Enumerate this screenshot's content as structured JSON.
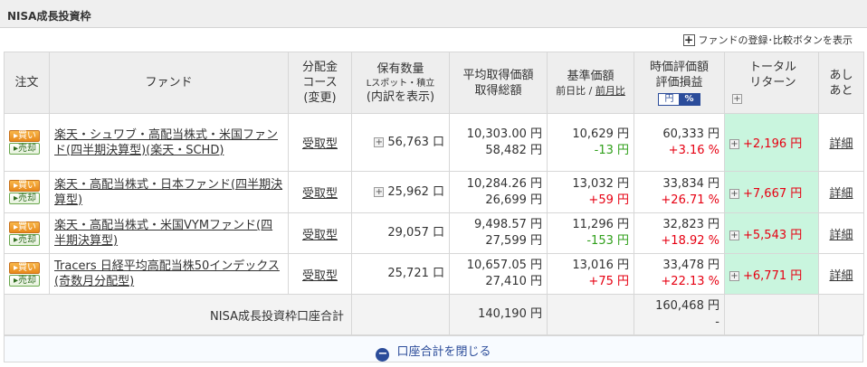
{
  "section_title": "NISA成長投資枠",
  "register_link": "ファンドの登録･比較ボタンを表示",
  "icons": {
    "plus": "plus-square-icon",
    "expand": "expand-plus-icon",
    "collapse": "minus-circle-icon"
  },
  "headers": {
    "order": "注文",
    "fund": "ファンド",
    "dist_l1": "分配金",
    "dist_l2": "コース",
    "dist_l3": "(変更)",
    "qty_l1": "保有数量",
    "qty_sub": "Lスポット・積立",
    "qty_l3": "(内訳を表示)",
    "avg_l1": "平均取得価額",
    "avg_l2": "取得総額",
    "nav_l1": "基準価額",
    "nav_sub_a": "前日比",
    "nav_sub_sep": " / ",
    "nav_sub_b": "前月比",
    "mv_l1": "時価評価額",
    "mv_l2": "評価損益",
    "toggle_yen": "円",
    "toggle_pct": "%",
    "tr_l1": "トータル",
    "tr_l2": "リターン",
    "ashi_l1": "あし",
    "ashi_l2": "あと"
  },
  "buttons": {
    "buy": "買い",
    "sell": "売却"
  },
  "colors": {
    "positive": "#e60012",
    "negative": "#2f9f1a",
    "accent": "#2b4c9a",
    "total_return_bg": "#c9f5de",
    "buy_button": "#f0a030"
  },
  "rows": [
    {
      "fund": "楽天・シュワブ・高配当株式・米国ファンド(四半期決算型)(楽天・SCHD)",
      "dist": "受取型",
      "qty": "56,763 口",
      "has_breakdown": true,
      "avg_price": "10,303.00 円",
      "total_cost": "58,482 円",
      "nav": "10,629 円",
      "nav_change": "-13 円",
      "market_value": "60,333 円",
      "pl_pct": "+3.16 %",
      "total_return": "+2,196 円",
      "detail": "詳細"
    },
    {
      "fund": "楽天・高配当株式・日本ファンド(四半期決算型)",
      "dist": "受取型",
      "qty": "25,962 口",
      "has_breakdown": true,
      "avg_price": "10,284.26 円",
      "total_cost": "26,699 円",
      "nav": "13,032 円",
      "nav_change": "+59 円",
      "market_value": "33,834 円",
      "pl_pct": "+26.71 %",
      "total_return": "+7,667 円",
      "detail": "詳細"
    },
    {
      "fund": "楽天・高配当株式・米国VYMファンド(四半期決算型)",
      "dist": "受取型",
      "qty": "29,057 口",
      "has_breakdown": false,
      "avg_price": "9,498.57 円",
      "total_cost": "27,599 円",
      "nav": "11,296 円",
      "nav_change": "-153 円",
      "market_value": "32,823 円",
      "pl_pct": "+18.92 %",
      "total_return": "+5,543 円",
      "detail": "詳細"
    },
    {
      "fund": "Tracers 日経平均高配当株50インデックス(奇数月分配型)",
      "dist": "受取型",
      "qty": "25,721 口",
      "has_breakdown": false,
      "avg_price": "10,657.05 円",
      "total_cost": "27,410 円",
      "nav": "13,016 円",
      "nav_change": "+75 円",
      "market_value": "33,478 円",
      "pl_pct": "+22.13 %",
      "total_return": "+6,771 円",
      "detail": "詳細"
    }
  ],
  "summary": {
    "label": "NISA成長投資枠口座合計",
    "total_cost": "140,190 円",
    "market_value": "160,468 円",
    "pl": "-"
  },
  "footer": {
    "collapse_label": "口座合計を閉じる"
  }
}
